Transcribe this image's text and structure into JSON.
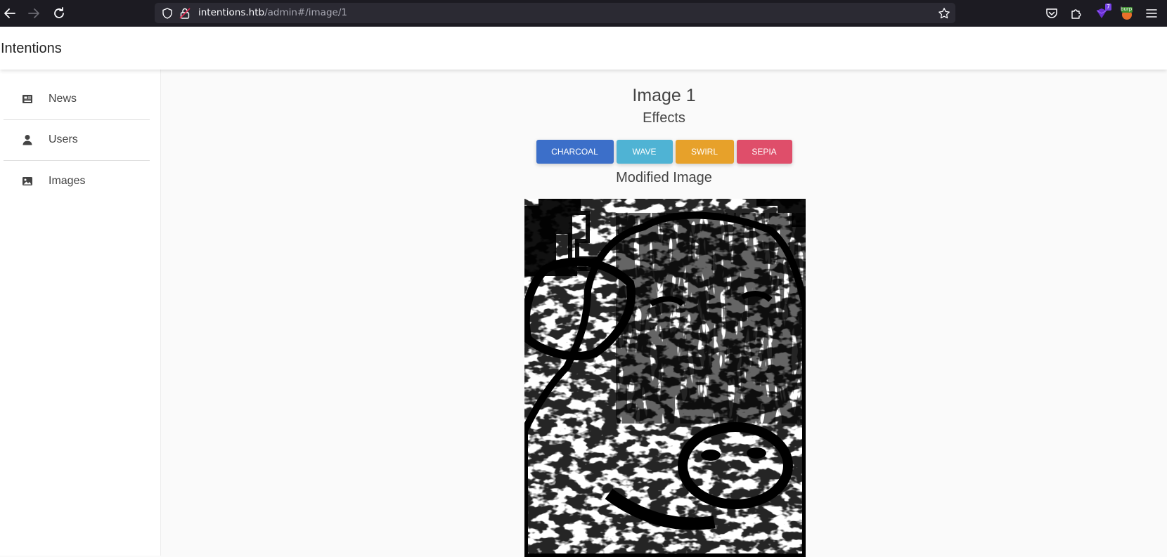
{
  "browser": {
    "url_host": "intentions.htb",
    "url_path": "/admin#/image/1",
    "extension_badge": "7",
    "extension_burp_label": "burp"
  },
  "app": {
    "brand": "Intentions"
  },
  "sidebar": {
    "items": [
      {
        "label": "News",
        "icon": "newspaper-icon"
      },
      {
        "label": "Users",
        "icon": "user-icon"
      },
      {
        "label": "Images",
        "icon": "image-icon"
      }
    ]
  },
  "main": {
    "title": "Image 1",
    "effects_heading": "Effects",
    "effects": [
      {
        "label": "CHARCOAL",
        "color": "#3c6fc9"
      },
      {
        "label": "WAVE",
        "color": "#4fb3d4"
      },
      {
        "label": "SWIRL",
        "color": "#e7a12a"
      },
      {
        "label": "SEPIA",
        "color": "#df4e6a"
      }
    ],
    "modified_heading": "Modified Image"
  }
}
